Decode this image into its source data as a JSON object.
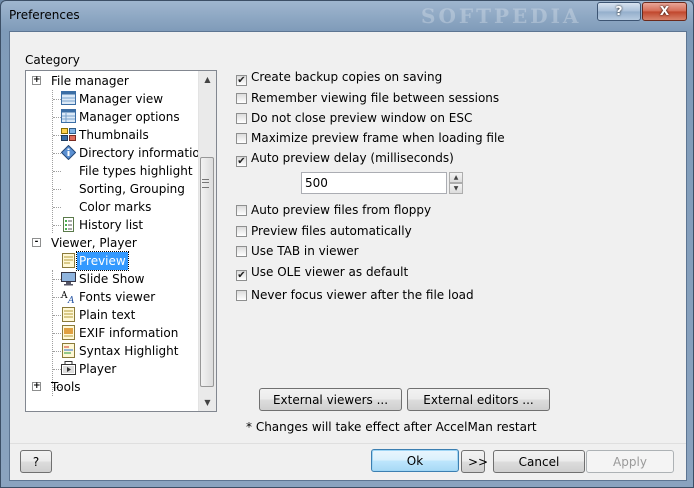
{
  "window": {
    "title": "Preferences",
    "watermark": "SOFTPEDIA",
    "help_button": "?",
    "close_button": "X",
    "colors": {
      "title_bar": "#8aa3bf",
      "selection": "#3399ff",
      "close": "#c0452b"
    }
  },
  "category": {
    "label": "Category",
    "tree": [
      {
        "label": "File manager",
        "expander": "+"
      },
      {
        "label": "Manager view",
        "icon": "grid-view-icon"
      },
      {
        "label": "Manager options",
        "icon": "grid-options-icon"
      },
      {
        "label": "Thumbnails",
        "icon": "thumbnails-icon"
      },
      {
        "label": "Directory information",
        "icon": "info-diamond-icon"
      },
      {
        "label": "File types highlight"
      },
      {
        "label": "Sorting, Grouping"
      },
      {
        "label": "Color marks"
      },
      {
        "label": "History list",
        "icon": "history-list-icon"
      },
      {
        "label": "Viewer, Player",
        "expander": "-"
      },
      {
        "label": "Preview",
        "icon": "preview-icon",
        "selected": true
      },
      {
        "label": "Slide Show",
        "icon": "monitor-icon"
      },
      {
        "label": "Fonts viewer",
        "icon": "font-icon"
      },
      {
        "label": "Plain text",
        "icon": "text-file-icon"
      },
      {
        "label": "EXIF information",
        "icon": "exif-icon"
      },
      {
        "label": "Syntax Highlight",
        "icon": "syntax-icon"
      },
      {
        "label": "Player",
        "icon": "player-icon"
      },
      {
        "label": "Tools",
        "expander": "+"
      }
    ]
  },
  "options": [
    {
      "label": "Create backup copies on saving",
      "checked": true
    },
    {
      "label": "Remember viewing file between sessions",
      "checked": false
    },
    {
      "label": "Do not close preview window on ESC",
      "checked": false
    },
    {
      "label": "Maximize preview frame when loading file",
      "checked": false
    },
    {
      "label": "Auto preview delay (milliseconds)",
      "checked": true
    },
    {
      "label": "Auto preview files from floppy",
      "checked": false
    },
    {
      "label": "Preview files automatically",
      "checked": false
    },
    {
      "label": "Use TAB in viewer",
      "checked": false
    },
    {
      "label": "Use OLE viewer as default",
      "checked": true
    },
    {
      "label": "Never focus viewer after the file load",
      "checked": false
    }
  ],
  "delay": {
    "value": "500"
  },
  "buttons": {
    "external_viewers": "External viewers ...",
    "external_editors": "External editors ...",
    "help": "?",
    "ok": "Ok",
    "next": ">>",
    "cancel": "Cancel",
    "apply": "Apply"
  },
  "note": "* Changes will take effect after AccelMan restart"
}
